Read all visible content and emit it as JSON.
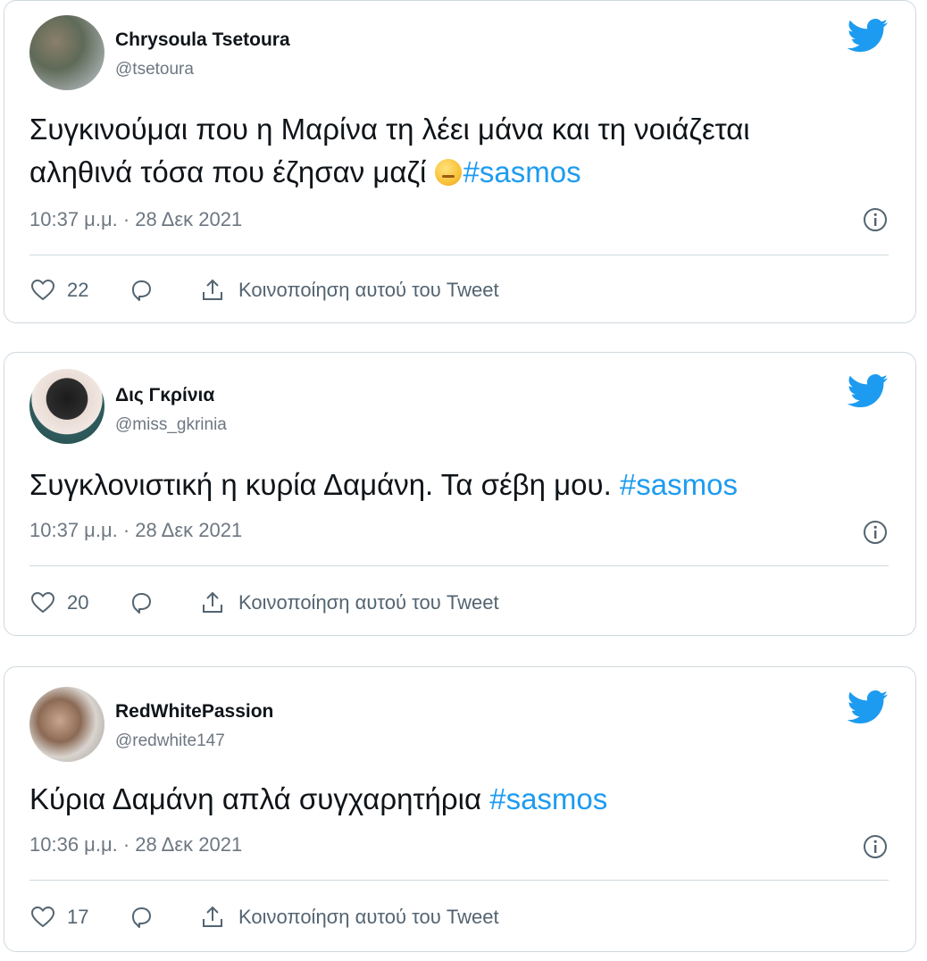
{
  "colors": {
    "link": "#1d9bf0",
    "muted": "#6e7781",
    "border": "#cfd9de"
  },
  "tweets": [
    {
      "name": "Chrysoula Tsetoura",
      "handle": "@tsetoura",
      "text_line1": "Συγκινούμαι που η Μαρίνα τη λέει μάνα και τη νοιάζεται",
      "text_line2": "αληθινά τόσα που έζησαν μαζί",
      "emoji": "sad-face-emoji",
      "hashtag": "#sasmos",
      "time": "10:37 μ.μ. · 28 Δεκ 2021",
      "likes": "22",
      "share_label": "Κοινοποίηση αυτού του Tweet"
    },
    {
      "name": "Δις Γκρίνια",
      "handle": "@miss_gkrinia",
      "text": "Συγκλονιστική η κυρία Δαμάνη. Τα σέβη μου. ",
      "hashtag": "#sasmos",
      "time": "10:37 μ.μ. · 28 Δεκ 2021",
      "likes": "20",
      "share_label": "Κοινοποίηση αυτού του Tweet"
    },
    {
      "name": "RedWhitePassion",
      "handle": "@redwhite147",
      "text": "Κύρια Δαμάνη απλά συγχαρητήρια ",
      "hashtag": "#sasmos",
      "time": "10:36 μ.μ. · 28 Δεκ 2021",
      "likes": "17",
      "share_label": "Κοινοποίηση αυτού του Tweet"
    }
  ],
  "icons": {
    "brand": "twitter-bird-icon",
    "info": "info-icon",
    "like": "heart-icon",
    "reply": "reply-icon",
    "share": "share-icon"
  }
}
